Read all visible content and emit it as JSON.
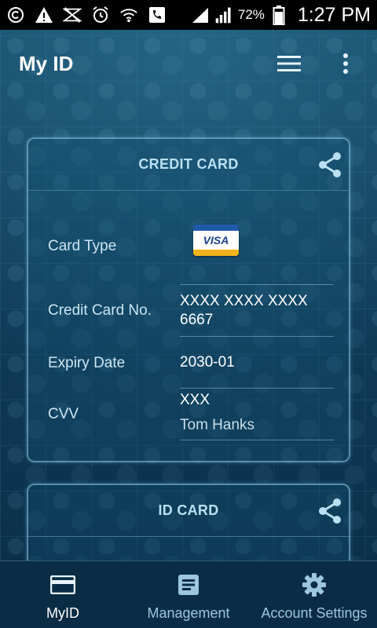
{
  "status_bar": {
    "battery": "72%",
    "time": "1:27 PM",
    "icons": [
      "copyright-icon",
      "warning-icon",
      "mute-icon",
      "alarm-icon",
      "wifi-icon",
      "phone-icon",
      "signal-icon",
      "signal-icon",
      "battery-icon"
    ]
  },
  "app_bar": {
    "title": "My ID",
    "icons": [
      "menu-icon",
      "overflow-icon"
    ]
  },
  "credit_card": {
    "title": "CREDIT CARD",
    "card_type_label": "Card Type",
    "card_type_logo": "VISA",
    "number_label": "Credit Card No.",
    "number_line1": "XXXX XXXX XXXX",
    "number_line2": "6667",
    "expiry_label": "Expiry Date",
    "expiry_value": "2030-01",
    "cvv_label": "CVV",
    "cvv_value": "XXX",
    "holder_name": "Tom Hanks"
  },
  "id_card": {
    "title": "ID CARD"
  },
  "bottom_nav": {
    "items": [
      {
        "label": "MyID",
        "icon": "card-icon",
        "active": true
      },
      {
        "label": "Management",
        "icon": "document-icon",
        "active": false
      },
      {
        "label": "Account Settings",
        "icon": "gear-icon",
        "active": false
      }
    ]
  },
  "colors": {
    "background": "#0f3c58",
    "card_border": "#96cdeb",
    "card_title": "#b9e0f2",
    "status_bar": "#000000"
  }
}
